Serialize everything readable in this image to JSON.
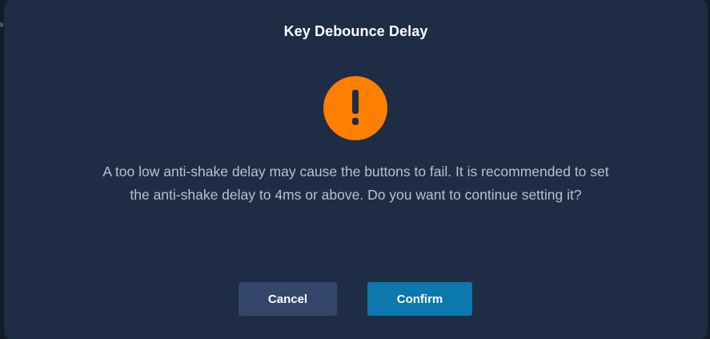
{
  "dialog": {
    "title": "Key Debounce Delay",
    "icon": "warning-exclamation-icon",
    "icon_color": "#ff7f00",
    "message": "A too low anti-shake delay may cause the buttons to fail. It is recommended to set the anti-shake delay to 4ms or above. Do you want to continue setting it?",
    "buttons": {
      "cancel_label": "Cancel",
      "confirm_label": "Confirm"
    }
  },
  "colors": {
    "dialog_background": "#1e2c45",
    "cancel_button": "#34476a",
    "confirm_button": "#0c78ac",
    "accent_warning": "#ff7f00"
  }
}
